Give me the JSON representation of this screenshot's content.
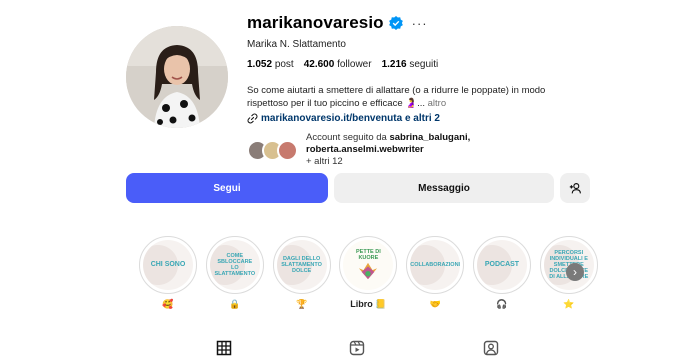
{
  "profile": {
    "username": "marikanovaresio",
    "full_name": "Marika N. Slattamento",
    "verified_icon": "verified-badge-icon",
    "verified_color": "#0095f6",
    "stats": {
      "posts_value": "1.052",
      "posts_label": "post",
      "followers_value": "42.600",
      "followers_label": "follower",
      "following_value": "1.216",
      "following_label": "seguiti"
    },
    "bio_line1": "So come aiutarti a smettere di allattare (o a ridurre le poppate) in modo",
    "bio_line2": "rispettoso per il tuo piccino e efficace 🤰...",
    "bio_more": "altro",
    "link_text": "marikanovaresio.it/benvenuta e altri 2",
    "followed_prefix": "Account seguito da",
    "followed_names": "sabrina_balugani, roberta.anselmi.webwriter",
    "followed_suffix": "+ altri 12"
  },
  "actions": {
    "follow_label": "Segui",
    "message_label": "Messaggio",
    "add_icon": "add-person-icon",
    "accent_color": "#4a5df9"
  },
  "highlights": [
    {
      "cover_text": "CHI SONO",
      "label": "🥰"
    },
    {
      "cover_text": "COME SBLOCCARE LO SLATTAMENTO",
      "label": "🔒"
    },
    {
      "cover_text": "DAGLI DELLO SLATTAMENTO DOLCE",
      "label": "🏆"
    },
    {
      "cover_text": "PETTE DI KUORE",
      "label": "Libro 📒"
    },
    {
      "cover_text": "COLLABORAZIONI",
      "label": "🤝"
    },
    {
      "cover_text": "PODCAST",
      "label": "🎧"
    },
    {
      "cover_text": "PERCORSI INDIVIDUALI E SMETTERE DOLCEMENTE DI ALLATTARE",
      "label": "⭐"
    }
  ],
  "tabs": [
    "grid-icon",
    "reels-icon",
    "tagged-icon"
  ]
}
